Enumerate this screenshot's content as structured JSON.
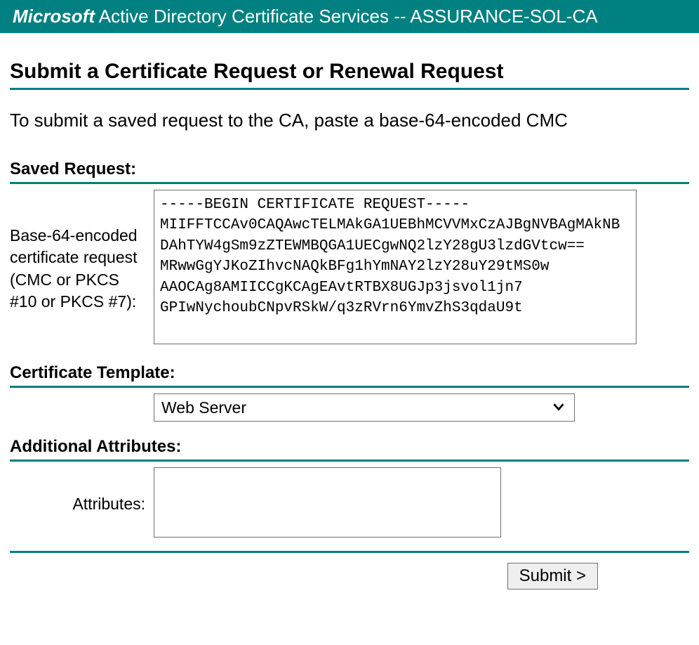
{
  "header": {
    "brand": "Microsoft",
    "service": " Active Directory Certificate Services ",
    "separator": " -- ",
    "ca_name": " ASSURANCE-SOL-CA"
  },
  "page_title": "Submit a Certificate Request or Renewal Request",
  "instruction": "To submit a saved request to the CA, paste a base-64-encoded CMC",
  "sections": {
    "saved_request": {
      "heading": "Saved Request:",
      "label": "Base-64-encoded certificate request (CMC or PKCS #10 or PKCS #7):",
      "value": "-----BEGIN CERTIFICATE REQUEST-----\nMIIFFTCCAv0CAQAwcTELMAkGA1UEBhMCVVMxCzAJBgNVBAgMAkNB\nDAhTYW4gSm9zZTEWMBQGA1UECgwNQ2lzY28gU3lzdGVtcw==\nMRwwGgYJKoZIhvcNAQkBFg1hYmNAY2lzY28uY29tMS0w\nAAOCAg8AMIICCgKCAgEAvtRTBX8UGJp3jsvol1jn7\nGPIwNychoubCNpvRSkW/q3zRVrn6YmvZhS3qdaU9t"
    },
    "certificate_template": {
      "heading": "Certificate Template:",
      "selected": "Web Server"
    },
    "additional_attributes": {
      "heading": "Additional Attributes:",
      "label": "Attributes:",
      "value": ""
    }
  },
  "buttons": {
    "submit": "Submit >"
  }
}
